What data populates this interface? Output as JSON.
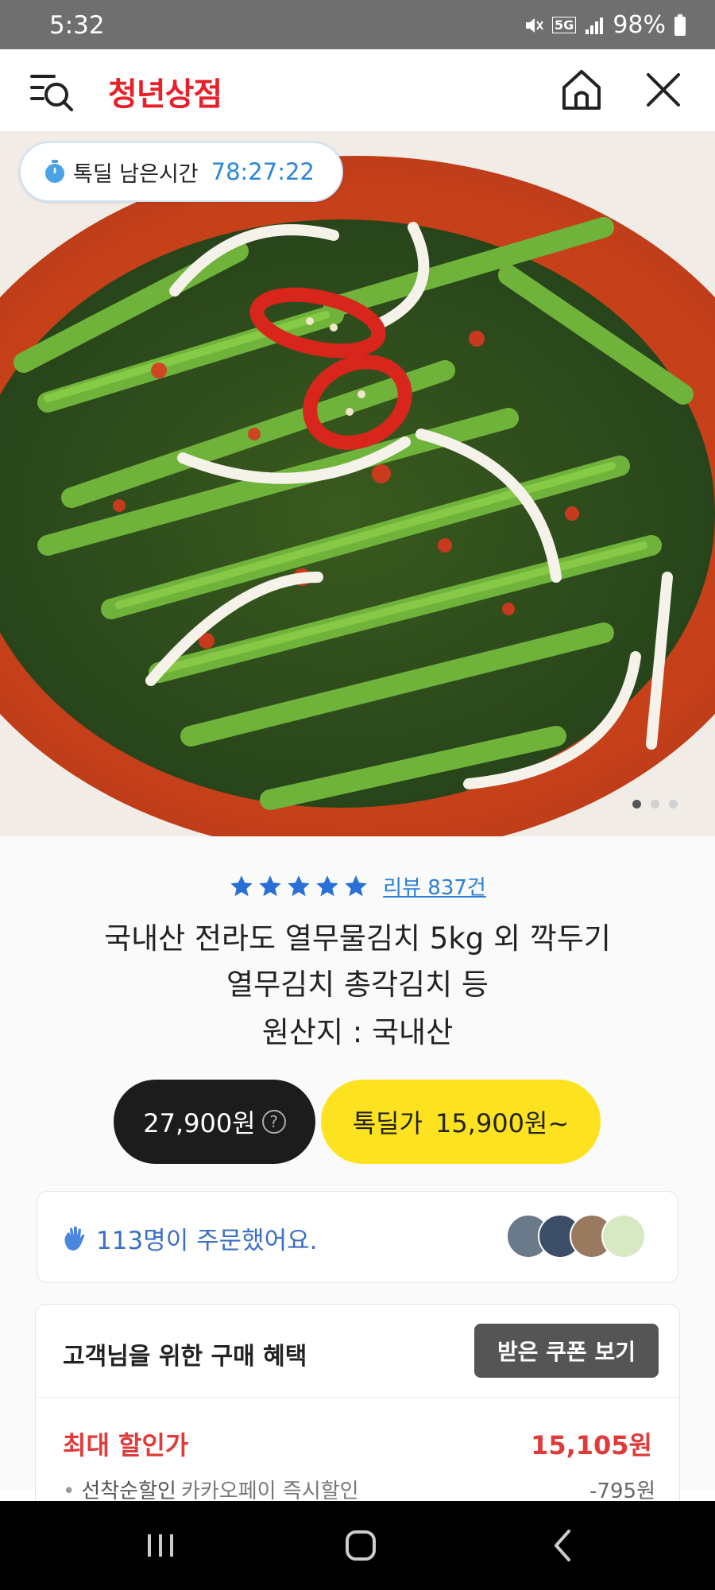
{
  "status_bar": {
    "time": "5:32",
    "network": "5G",
    "battery": "98%"
  },
  "header": {
    "brand": "청년상점",
    "brand_color": "#e8202a"
  },
  "hero": {
    "timer_label": "톡딜 남은시간",
    "timer_value": "78:27:22",
    "slide_total": 3,
    "slide_current": 1
  },
  "product": {
    "rating_stars": 5,
    "review_link": "리뷰 837건",
    "title_line1": "국내산 전라도 열무물김치 5kg 외 깍두기",
    "title_line2": "열무김치 총각김치 등",
    "origin": "원산지 : 국내산",
    "original_price": "27,900원",
    "deal_label": "톡딜가",
    "deal_price": "15,900원~",
    "orders_text": "113명이 주문했어요."
  },
  "benefits": {
    "title": "고객님을 위한 구매 혜택",
    "coupon_button": "받은 쿠폰 보기",
    "max_label": "최대 할인가",
    "max_value": "15,105원",
    "sub_label": "선착순할인",
    "sub_desc": "카카오페이 즉시할인",
    "sub_amount": "-795원"
  },
  "colors": {
    "accent_blue": "#2a86d8",
    "deal_yellow": "#fde31f",
    "discount_red": "#e03a3a"
  }
}
